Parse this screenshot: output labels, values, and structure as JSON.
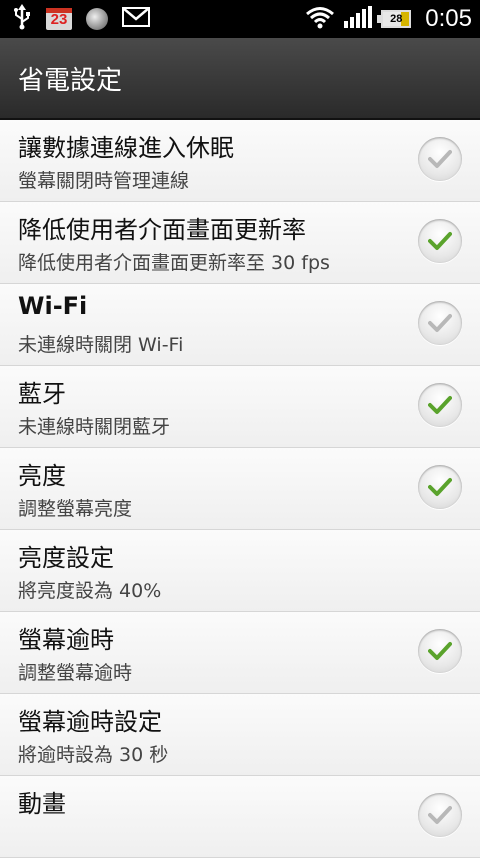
{
  "status_bar": {
    "calendar_day": "23",
    "battery_level": "28",
    "time": "0:05",
    "icons": [
      "usb-icon",
      "calendar-icon",
      "moon-icon",
      "gmail-icon",
      "wifi-icon",
      "signal-icon",
      "battery-icon"
    ]
  },
  "header": {
    "title": "省電設定"
  },
  "colors": {
    "check_on": "#5aa32c",
    "check_off": "#b8b8b8"
  },
  "settings": [
    {
      "label": "讓數據連線進入休眠",
      "summary": "螢幕關閉時管理連線",
      "checked": false
    },
    {
      "label": "降低使用者介面畫面更新率",
      "summary": "降低使用者介面畫面更新率至 30 fps",
      "checked": true
    },
    {
      "label": "Wi-Fi",
      "summary": "未連線時關閉 Wi-Fi",
      "checked": false
    },
    {
      "label": "藍牙",
      "summary": "未連線時關閉藍牙",
      "checked": true
    },
    {
      "label": "亮度",
      "summary": "調整螢幕亮度",
      "checked": true
    },
    {
      "label": "亮度設定",
      "summary": "將亮度設為 40%"
    },
    {
      "label": "螢幕逾時",
      "summary": "調整螢幕逾時",
      "checked": true
    },
    {
      "label": "螢幕逾時設定",
      "summary": "將逾時設為 30 秒"
    },
    {
      "label": "動畫",
      "summary": ""
    }
  ]
}
